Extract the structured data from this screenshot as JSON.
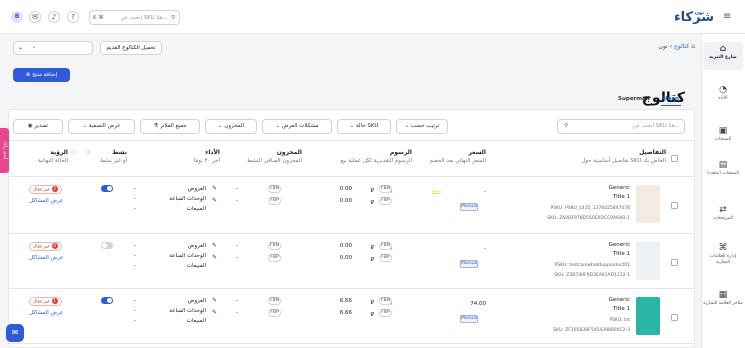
{
  "topbar": {
    "avatar": "B",
    "search_placeholder": "ابحث عن SKU هنا...",
    "search_shortcut": "K ⌘",
    "logo": "شركاء",
    "logo_sub": "نون"
  },
  "sidebar": {
    "items": [
      {
        "label": "شارع التنزيه",
        "icon": "⬚"
      },
      {
        "label": "الأداء",
        "icon": "◔"
      },
      {
        "label": "المنتجات",
        "icon": "▣"
      },
      {
        "label": "المنتجات (متعدد)",
        "icon": "▤"
      },
      {
        "label": "المرتجعات",
        "icon": "⇄"
      },
      {
        "label": "إدارة العلامات التجارية",
        "icon": "⌂"
      },
      {
        "label": "متاجر العلامة التجارية",
        "icon": "▦"
      }
    ]
  },
  "header": {
    "breadcrumb_home": "نون",
    "breadcrumb_current": "كتالوج",
    "title": "كتالوج",
    "add_button": "إضافة منتج",
    "download_button": "تحميل الكتالوج القديم",
    "dropdown_value": "-"
  },
  "tabs": [
    "Noon",
    "Supermall"
  ],
  "filters": {
    "search_placeholder": "ابحث عن SKU هنا...",
    "sort": "ترتيب حسب",
    "status": "حالة SKU",
    "issues": "مشكلات العرض",
    "stock": "المخزون",
    "all_filters": "جميع الفلاتر",
    "offer_type": "عرض التصفية",
    "export": "تصدير"
  },
  "table": {
    "headers": {
      "details": "التفاصيل",
      "details_sub": "تفاصيل أساسية حول SKU الخاص بك",
      "price": "السعر",
      "price_sub": "السعر النهائي بعد الخصم",
      "fees": "الرسوم",
      "fees_sub": "الرسوم التقديرية لكل عملية بيع",
      "stock": "المخزون",
      "stock_sub": "المخزون الصافي النشط",
      "perf": "الأداء",
      "perf_sub": "آخر ٣٠ يومًا",
      "active": "نشط",
      "active_sub": "أو غير نشط",
      "visibility": "الرؤية",
      "visibility_sub": "الحالة النهائية"
    },
    "rows": [
      {
        "brand": "Generic",
        "name": "Title 1",
        "psku": "PSKU: PSKU_1435_1376025847078",
        "sku": "SKU: Z60DF978D550E0DCC0A6AD-1",
        "price": "-",
        "price_mode": "Manual",
        "fee_fbn": "0.00",
        "fee_fbp": "0.00",
        "stock_fbn": "-",
        "stock_fbp": "-",
        "perf": [
          "العروض",
          "الوحدات المباعة",
          "المبيعات"
        ],
        "perf_vals": [
          "-",
          "-",
          "-"
        ],
        "active": true,
        "vis_label": "غير فعال",
        "vis_count": "2",
        "vis_link": "عرض المشاكل",
        "thumb_color": "#f4ece2"
      },
      {
        "brand": "Generic",
        "name": "Title 1",
        "psku": "PSKU: testcaniwhatdupproduct01",
        "sku": "SKU: Z3D740F9D3EA61AD1232-1",
        "price": "-",
        "price_mode": "Manual",
        "fee_fbn": "0.00",
        "fee_fbp": "0.00",
        "stock_fbn": "-",
        "stock_fbp": "-",
        "perf": [
          "العروض",
          "الوحدات المباعة",
          "المبيعات"
        ],
        "perf_vals": [
          "-",
          "-",
          "-"
        ],
        "active": false,
        "vis_label": "غير فعال",
        "vis_count": "4",
        "vis_link": "عرض المشاكل",
        "thumb_color": "#eef1f4"
      },
      {
        "brand": "Generic",
        "name": "Title 1",
        "psku": "PSKU: tst",
        "sku": "SKU: ZF105B38F5454298800C2-3",
        "price": "74.00",
        "price_mode": "Manual",
        "fee_fbn": "6.66",
        "fee_fbp": "6.66",
        "stock_fbn": "-",
        "stock_fbp": "-",
        "perf": [
          "العروض",
          "الوحدات المباعة",
          "المبيعات"
        ],
        "perf_vals": [
          "-",
          "-",
          "-"
        ],
        "active": true,
        "vis_label": "غير فعال",
        "vis_count": "1",
        "vis_link": "عرض المشاكل",
        "thumb_color": "#2bb5a5"
      }
    ],
    "fbn_label": "FBN",
    "fbp_label": "FBP",
    "currency": "⃁"
  },
  "feedback_tab": "أبدي رأيك"
}
